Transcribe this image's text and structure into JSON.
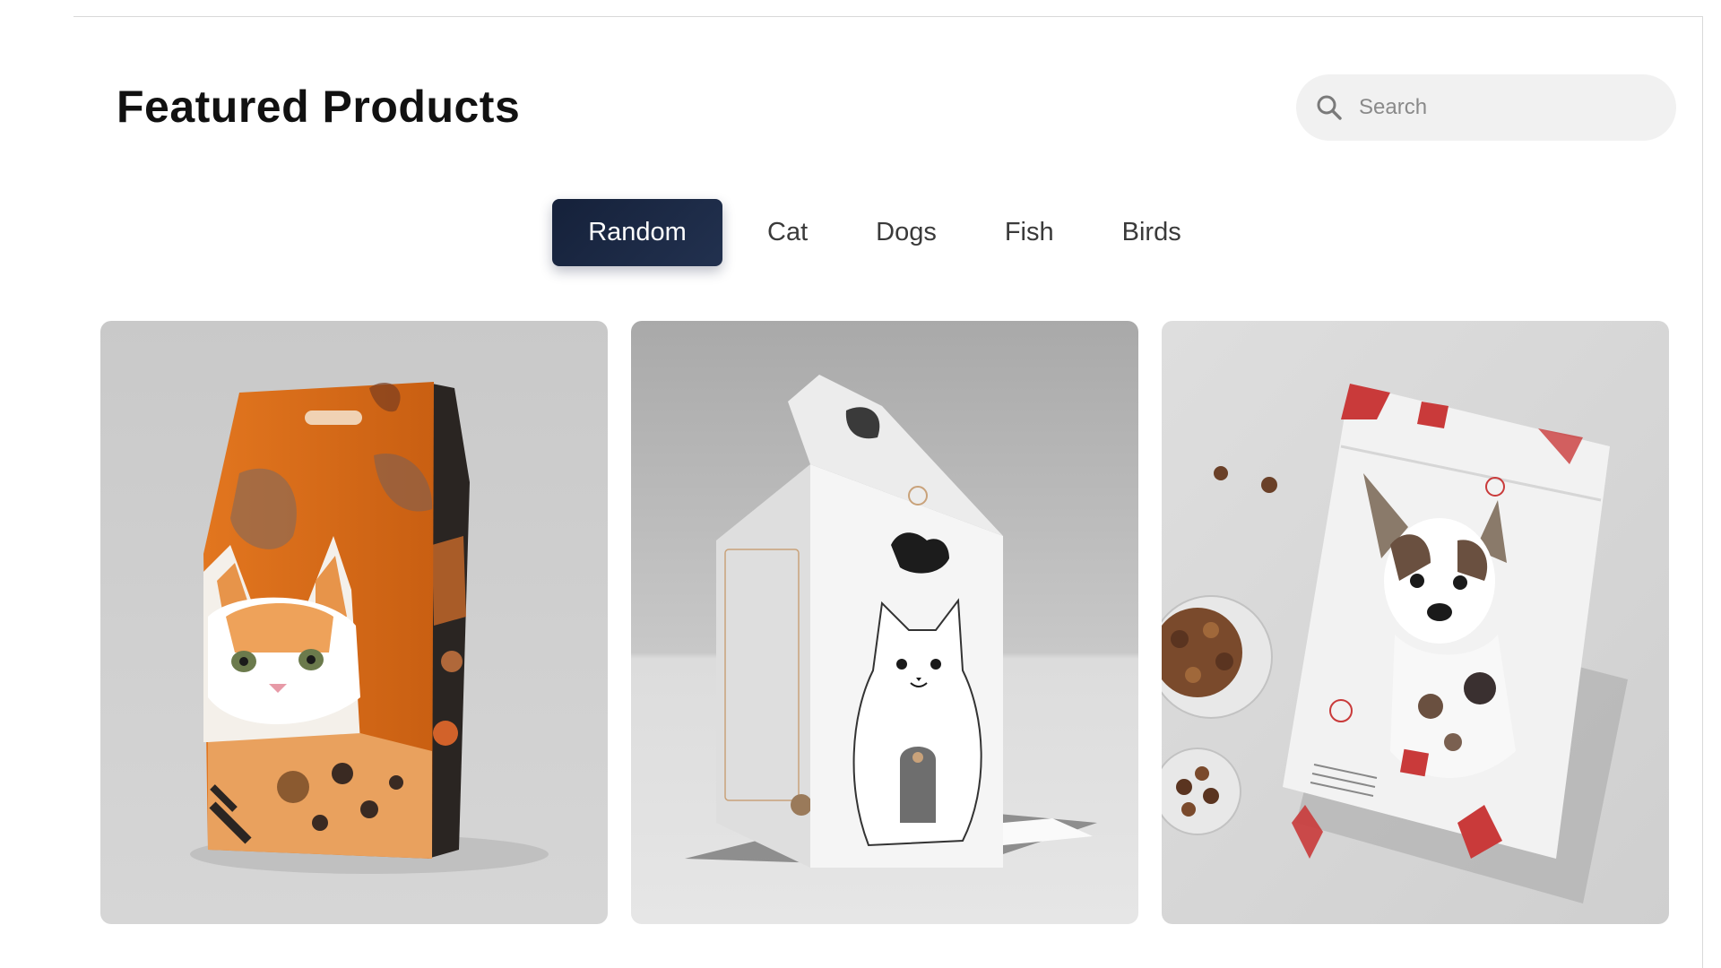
{
  "header": {
    "title": "Featured Products"
  },
  "search": {
    "placeholder": "Search",
    "value": ""
  },
  "tabs": [
    {
      "label": "Random",
      "active": true
    },
    {
      "label": "Cat",
      "active": false
    },
    {
      "label": "Dogs",
      "active": false
    },
    {
      "label": "Fish",
      "active": false
    },
    {
      "label": "Birds",
      "active": false
    }
  ],
  "colors": {
    "accent": "#1a2742",
    "tab_text": "#3a3a3a",
    "search_bg": "#f1f1f1"
  },
  "products": [
    {
      "icon": "cat-food-bag-image"
    },
    {
      "icon": "cat-food-box-image"
    },
    {
      "icon": "dog-food-pouch-image"
    }
  ]
}
